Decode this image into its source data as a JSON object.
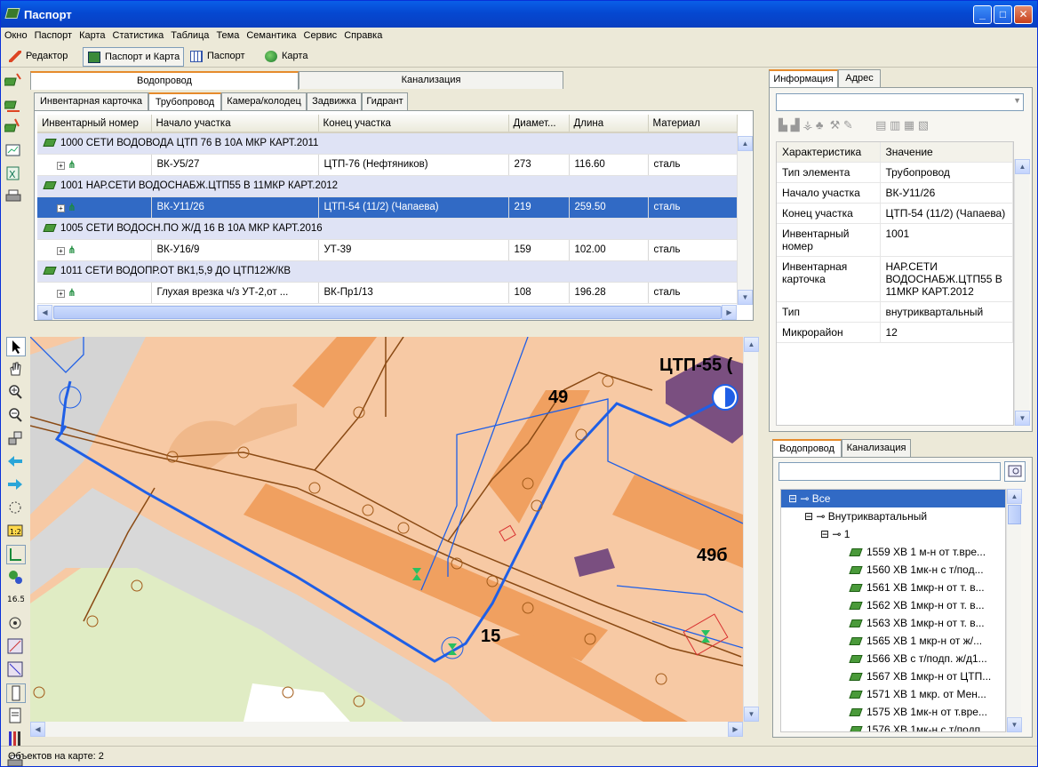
{
  "window": {
    "title": "Паспорт"
  },
  "menu": [
    "Окно",
    "Паспорт",
    "Карта",
    "Статистика",
    "Таблица",
    "Тема",
    "Семантика",
    "Сервис",
    "Справка"
  ],
  "toolbar": {
    "editor": "Редактор",
    "passport_map": "Паспорт и Карта",
    "passport": "Паспорт",
    "map": "Карта"
  },
  "top_tabs": [
    "Водопровод",
    "Канализация"
  ],
  "sub_tabs": [
    "Инвентарная карточка",
    "Трубопровод",
    "Камера/колодец",
    "Задвижка",
    "Гидрант"
  ],
  "grid": {
    "columns": [
      "Инвентарный номер",
      "Начало участка",
      "Конец участка",
      "Диамет...",
      "Длина",
      "Материал"
    ],
    "rows": [
      {
        "type": "group",
        "text": "1000  СЕТИ ВОДОВОДА ЦТП 76 В 10А МКР КАРТ.2011"
      },
      {
        "type": "item",
        "start": "ВК-У5/27",
        "end": "ЦТП-76 (Нефтяников)",
        "diam": "273",
        "len": "116.60",
        "mat": "сталь"
      },
      {
        "type": "group",
        "text": "1001  НАР.СЕТИ ВОДОСНАБЖ.ЦТП55 В 11МКР КАРТ.2012"
      },
      {
        "type": "item",
        "sel": true,
        "start": "ВК-У11/26",
        "end": "ЦТП-54 (11/2) (Чапаева)",
        "diam": "219",
        "len": "259.50",
        "mat": "сталь"
      },
      {
        "type": "group",
        "text": "1005  СЕТИ ВОДОСН.ПО Ж/Д 16 В 10А МКР КАРТ.2016"
      },
      {
        "type": "item",
        "start": "ВК-У16/9",
        "end": "УТ-39",
        "diam": "159",
        "len": "102.00",
        "mat": "сталь"
      },
      {
        "type": "group",
        "text": "1011  СЕТИ ВОДОПР.ОТ ВК1,5,9 ДО ЦТП12Ж/КВ"
      },
      {
        "type": "item",
        "start": "Глухая врезка ч/з УТ-2,от ...",
        "end": "ВК-Пр1/13",
        "diam": "108",
        "len": "196.28",
        "mat": "сталь"
      }
    ]
  },
  "map_labels": {
    "ctp": "ЦТП-55 (",
    "b49": "49",
    "b49b": "49б",
    "b15": "15"
  },
  "info_tabs": [
    "Информация",
    "Адрес"
  ],
  "props": {
    "headers": [
      "Характеристика",
      "Значение"
    ],
    "rows": [
      {
        "k": "Тип элемента",
        "v": "Трубопровод"
      },
      {
        "k": "Начало участка",
        "v": "ВК-У11/26"
      },
      {
        "k": "Конец участка",
        "v": "ЦТП-54 (11/2) (Чапаева)"
      },
      {
        "k": "Инвентарный номер",
        "v": "1001"
      },
      {
        "k": "Инвентарная карточка",
        "v": "НАР.СЕТИ ВОДОСНАБЖ.ЦТП55 В 11МКР КАРТ.2012"
      },
      {
        "k": "Тип",
        "v": "внутриквартальный"
      },
      {
        "k": "Микрорайон",
        "v": "12"
      }
    ]
  },
  "tree_tabs": [
    "Водопровод",
    "Канализация"
  ],
  "tree": {
    "root": "Все",
    "level1": "Внутриквартальный",
    "level2": "1",
    "items": [
      "1559  ХВ 1 м-н от т.вре...",
      "1560  ХВ 1мк-н с т/под...",
      "1561  ХВ 1мкр-н от т. в...",
      "1562  ХВ 1мкр-н от т. в...",
      "1563  ХВ 1мкр-н от т. в...",
      "1565  ХВ 1 мкр-н от ж/...",
      "1566  ХВ с т/подп. ж/д1...",
      "1567  ХВ 1мкр-н от ЦТП...",
      "1571  ХВ 1 мкр. от Мен...",
      "1575  ХВ 1мк-н от т.вре...",
      "1576  ХВ 1мк-н с т/подп"
    ]
  },
  "status": "Объектов на карте: 2",
  "colors": {
    "select": "#316ac5",
    "group_row": "#dfe3f5",
    "water_pipe": "#1f5fe6",
    "heat_pipe": "#8a4a14",
    "building": "#f0a060",
    "ctp_building": "#7a4f80"
  }
}
